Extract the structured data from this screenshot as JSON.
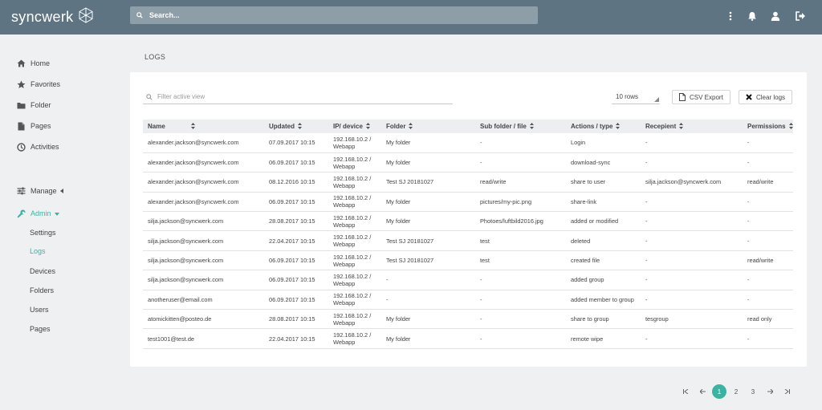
{
  "app": {
    "name": "syncwerk"
  },
  "search": {
    "placeholder": "Search..."
  },
  "topbar": {
    "icons": [
      "more-vertical-icon",
      "bell-icon",
      "user-icon",
      "sign-out-icon"
    ]
  },
  "sidebar": {
    "items": [
      {
        "label": "Home",
        "icon": "home-icon"
      },
      {
        "label": "Favorites",
        "icon": "star-icon"
      },
      {
        "label": "Folder",
        "icon": "folder-icon"
      },
      {
        "label": "Pages",
        "icon": "file-icon"
      },
      {
        "label": "Activities",
        "icon": "clock-icon"
      }
    ],
    "manage": {
      "label": "Manage",
      "icon": "sliders-icon"
    },
    "admin": {
      "label": "Admin",
      "icon": "wrench-icon"
    },
    "admin_items": [
      "Settings",
      "Logs",
      "Devices",
      "Folders",
      "Users",
      "Pages"
    ],
    "active_item": "Logs"
  },
  "page": {
    "title": "LOGS"
  },
  "toolbar": {
    "filter_placeholder": "Filter active view",
    "rows_value": "10 rows",
    "csv_label": "CSV Export",
    "clear_label": "Clear logs"
  },
  "table": {
    "columns": [
      "Name",
      "Updated",
      "IP/ device",
      "Folder",
      "Sub folder / file",
      "Actions / type",
      "Recepient",
      "Permissions"
    ],
    "rows": [
      [
        "alexander.jackson@syncwerk.com",
        "07.09.2017 10:15",
        "192.168.10.2 / Webapp",
        "My folder",
        "-",
        "Login",
        "-",
        "-"
      ],
      [
        "alexander.jackson@syncwerk.com",
        "06.09.2017 10:15",
        "192.168.10.2 / Webapp",
        "My folder",
        "-",
        "download-sync",
        "-",
        "-"
      ],
      [
        "alexander.jackson@syncwerk.com",
        "08.12.2016 10:15",
        "192.168.10.2 / Webapp",
        "Test SJ 20181027",
        "read/write",
        "share to user",
        "silja.jackson@syncwerk.com",
        "read/write"
      ],
      [
        "alexander.jackson@syncwerk.com",
        "06.09.2017 10:15",
        "192.168.10.2 / Webapp",
        "My folder",
        "pictures/my-pic.png",
        "share-link",
        "-",
        "-"
      ],
      [
        "silja.jackson@syncwerk.com",
        "28.08.2017 10:15",
        "192.168.10.2 / Webapp",
        "My folder",
        "Photoes/luftbild2016.jpg",
        "added or modified",
        "-",
        "-"
      ],
      [
        "silja.jackson@syncwerk.com",
        "22.04.2017 10:15",
        "192.168.10.2 / Webapp",
        "Test SJ 20181027",
        "test",
        "deleted",
        "-",
        "-"
      ],
      [
        "silja.jackson@syncwerk.com",
        "06.09.2017 10:15",
        "192.168.10.2 / Webapp",
        "Test SJ 20181027",
        "test",
        "created file",
        "-",
        "read/write"
      ],
      [
        "silja.jackson@syncwerk.com",
        "06.09.2017 10:15",
        "192.168.10.2 / Webapp",
        "-",
        "-",
        "added group",
        "-",
        "-"
      ],
      [
        "anotheruser@email.com",
        "06.09.2017 10:15",
        "192.168.10.2 / Webapp",
        "-",
        "-",
        "added member to group",
        "-",
        "-"
      ],
      [
        "atomickitten@posteo.de",
        "28.08.2017 10:15",
        "192.168.10.2 / Webapp",
        "My folder",
        "-",
        "share to group",
        "tesgroup",
        "read only"
      ],
      [
        "test1001@test.de",
        "22.04.2017 10:15",
        "192.168.10.2 / Webapp",
        "My folder",
        "-",
        "remote wipe",
        "-",
        "-"
      ]
    ]
  },
  "pagination": {
    "pages": [
      "1",
      "2",
      "3"
    ],
    "current": "1"
  },
  "colors": {
    "topbar": "#5e7483",
    "accent": "#3bb3a3",
    "background": "#eef0f2"
  }
}
